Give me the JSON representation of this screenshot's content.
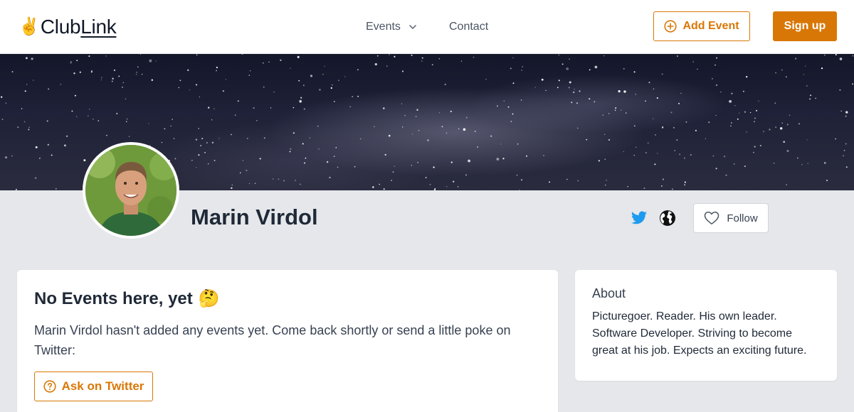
{
  "navbar": {
    "logo_emoji": "✌️",
    "logo_text_a": "Club",
    "logo_text_b": "Link",
    "links": {
      "events": "Events",
      "contact": "Contact"
    },
    "add_event_label": "Add Event",
    "signup_label": "Sign up"
  },
  "profile": {
    "name": "Marin Virdol",
    "social": [
      "twitter-icon",
      "globe-icon"
    ],
    "follow_label": "Follow"
  },
  "events_card": {
    "title": "No Events here, yet",
    "title_emoji": "🤔",
    "body": "Marin Virdol hasn't added any events yet. Come back shortly or send a little poke on Twitter:",
    "ask_button_label": "Ask on Twitter"
  },
  "about_card": {
    "title": "About",
    "body": "Picturegoer. Reader. His own leader. Software Developer. Striving to become great at his job. Expects an exciting future."
  },
  "colors": {
    "accent": "#d97706",
    "page_background": "#e5e7eb",
    "twitter_blue": "#1d9bf0"
  },
  "icons": {
    "dropdown": "chevron-down-icon",
    "add_event": "plus-circle-icon",
    "follow": "heart-icon",
    "ask": "question-circle-icon"
  }
}
